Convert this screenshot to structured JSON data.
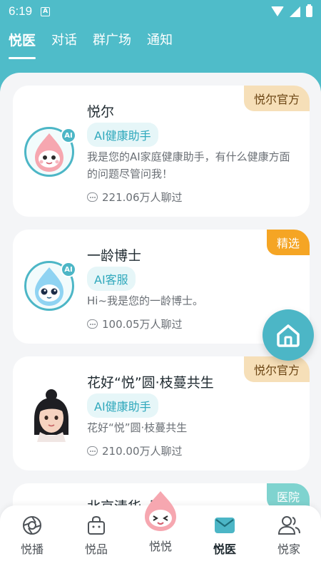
{
  "status": {
    "time": "6:19",
    "a_icon": "A"
  },
  "tabs": [
    {
      "label": "悦医",
      "active": true
    },
    {
      "label": "对话",
      "active": false
    },
    {
      "label": "群广场",
      "active": false
    },
    {
      "label": "通知",
      "active": false
    }
  ],
  "cards": [
    {
      "badge": "悦尔官方",
      "title": "悦尔",
      "tag": "AI健康助手",
      "desc": "我是您的AI家庭健康助手，有什么健康方面的问题尽管问我！",
      "stat": "221.06万人聊过",
      "avatar_badge": "AI"
    },
    {
      "badge": "精选",
      "title": "一龄博士",
      "tag": "AI客服",
      "desc": "Hi~我是您的一龄博士。",
      "stat": "100.05万人聊过",
      "avatar_badge": "AI"
    },
    {
      "badge": "悦尔官方",
      "title": "花好“悦”圆·枝蔓共生",
      "tag": "AI健康助手",
      "desc": "花好“悦”圆·枝蔓共生",
      "stat": "210.00万人聊过"
    },
    {
      "badge": "医院",
      "title": "北京清华··院"
    }
  ],
  "nav": [
    {
      "label": "悦播",
      "icon": "aperture-icon"
    },
    {
      "label": "悦品",
      "icon": "shopping-bag-icon"
    },
    {
      "label": "悦悦",
      "icon": "mascot-icon"
    },
    {
      "label": "悦医",
      "icon": "envelope-icon",
      "active": true
    },
    {
      "label": "悦家",
      "icon": "people-icon"
    }
  ],
  "colors": {
    "primary": "#4cb6c6",
    "background": "#4fbcc9",
    "official_badge": "#f6dfb8",
    "pick_badge": "#f5a524"
  }
}
